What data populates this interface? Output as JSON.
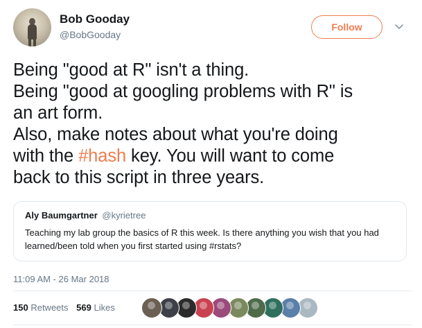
{
  "author": {
    "name": "Bob Gooday",
    "handle": "@BobGooday",
    "avatar_icon": "user-avatar-photo"
  },
  "follow_button": {
    "label": "Follow",
    "color": "#f07d4f"
  },
  "menu_icon": "chevron-down-icon",
  "tweet": {
    "line1": "Being \"good at R\" isn't a thing.",
    "line2": "Being \"good at googling problems with R\" is",
    "line3": "an art form.",
    "line4": "Also, make notes about what you're doing",
    "line5_before": "with the ",
    "line5_hashtag": "#hash",
    "line5_after": " key. You will want to come",
    "line6": "back to this script in three years."
  },
  "quoted_tweet": {
    "name": "Aly Baumgartner",
    "handle": "@kyrietree",
    "text": "Teaching my lab group the basics of R this week. Is there anything you wish that you had learned/been told when you first started using #rstats?"
  },
  "timestamp": "11:09 AM - 26 Mar 2018",
  "stats": {
    "retweets_count": "150",
    "retweets_label": "Retweets",
    "likes_count": "569",
    "likes_label": "Likes"
  },
  "likers": [
    {
      "name": "liker-avatar-1",
      "color": "#6b5f54"
    },
    {
      "name": "liker-avatar-2",
      "color": "#3d4048"
    },
    {
      "name": "liker-avatar-3",
      "color": "#2b2b2b"
    },
    {
      "name": "liker-avatar-4",
      "color": "#c9424f"
    },
    {
      "name": "liker-avatar-5",
      "color": "#9b4a7a"
    },
    {
      "name": "liker-avatar-6",
      "color": "#7a8a5e"
    },
    {
      "name": "liker-avatar-7",
      "color": "#4f6b4a"
    },
    {
      "name": "liker-avatar-8",
      "color": "#2f6f5e"
    },
    {
      "name": "liker-avatar-9",
      "color": "#5a7fa8"
    },
    {
      "name": "liker-avatar-10",
      "color": "#aab8c2"
    }
  ],
  "colors": {
    "accent": "#f07d4f",
    "text": "#14171a",
    "muted": "#657786",
    "border": "#e1e8ed"
  }
}
